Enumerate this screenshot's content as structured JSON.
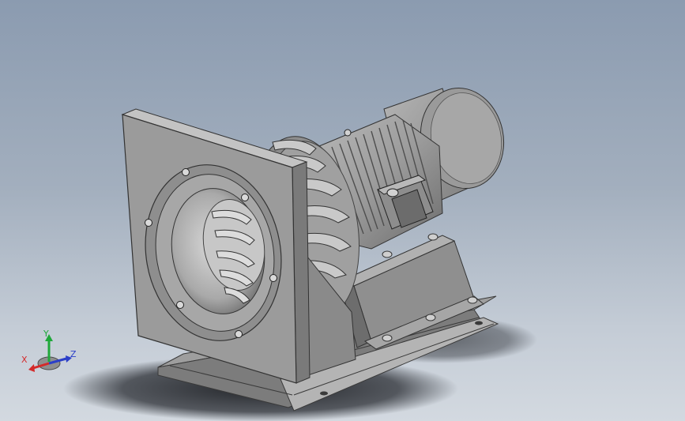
{
  "triad": {
    "x_label": "X",
    "y_label": "Y",
    "z_label": "Z",
    "x_color": "#d42a2a",
    "y_color": "#1fa83a",
    "z_color": "#2b3fc8"
  },
  "model": {
    "icons": [
      "centrifugal-fan-model"
    ],
    "body_color": "#9a9a9a",
    "dark_color": "#5f5f5f",
    "light_color": "#c4c4c4"
  }
}
